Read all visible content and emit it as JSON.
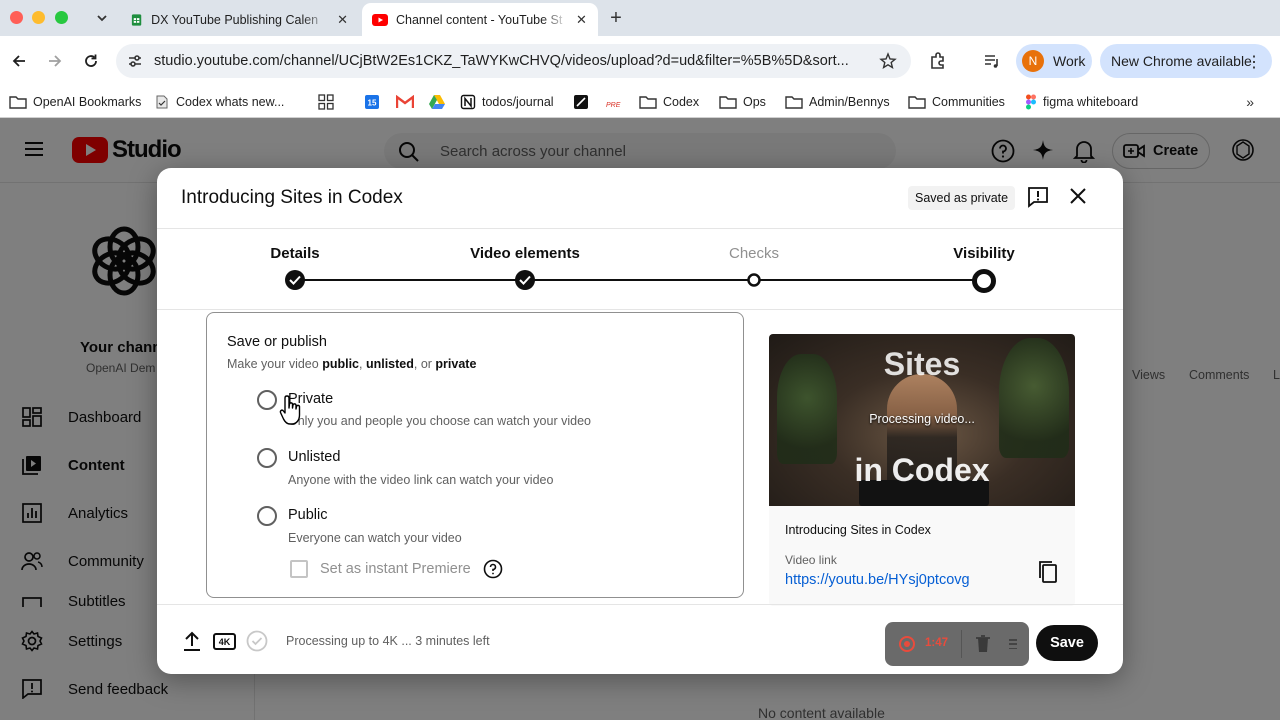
{
  "browser": {
    "tabs": [
      {
        "title": "DX YouTube Publishing Calen",
        "favicon": "sheets-icon"
      },
      {
        "title": "Channel content - YouTube St",
        "favicon": "youtube-icon"
      }
    ],
    "url": "studio.youtube.com/channel/UCjBtW2Es1CKZ_TaWYKwCHVQ/videos/upload?d=ud&filter=%5B%5D&sort...",
    "profile": {
      "initial": "N",
      "label": "Work"
    },
    "update_label": "New Chrome available",
    "bookmarks": [
      {
        "label": "OpenAI Bookmarks",
        "icon": "folder-icon"
      },
      {
        "label": "Codex whats new...",
        "icon": "page-icon"
      },
      {
        "label": "",
        "icon": "grid-icon"
      },
      {
        "label": "",
        "icon": "calendar-icon"
      },
      {
        "label": "",
        "icon": "gmail-icon"
      },
      {
        "label": "",
        "icon": "drive-icon"
      },
      {
        "label": "todos/journal",
        "icon": "notion-icon"
      },
      {
        "label": "",
        "icon": "bookmark-icon"
      },
      {
        "label": "",
        "icon": "pre-icon"
      },
      {
        "label": "Codex",
        "icon": "folder-icon"
      },
      {
        "label": "Ops",
        "icon": "folder-icon"
      },
      {
        "label": "Admin/Bennys",
        "icon": "folder-icon"
      },
      {
        "label": "Communities",
        "icon": "folder-icon"
      },
      {
        "label": "figma whiteboard",
        "icon": "figma-icon"
      }
    ]
  },
  "studio": {
    "logo_text": "Studio",
    "search_placeholder": "Search across your channel",
    "create_label": "Create",
    "channel_name": "Your chann",
    "channel_sub": "OpenAI Dem",
    "nav": [
      {
        "label": "Dashboard",
        "icon": "dashboard-icon"
      },
      {
        "label": "Content",
        "icon": "content-icon"
      },
      {
        "label": "Analytics",
        "icon": "analytics-icon"
      },
      {
        "label": "Community",
        "icon": "community-icon"
      },
      {
        "label": "Subtitles",
        "icon": "subtitles-icon"
      },
      {
        "label": "Settings",
        "icon": "settings-icon"
      },
      {
        "label": "Send feedback",
        "icon": "feedback-icon"
      }
    ],
    "columns": [
      "Views",
      "Comments",
      "L"
    ],
    "empty_text": "No content available"
  },
  "dialog": {
    "title": "Introducing Sites in Codex",
    "saved_badge": "Saved as private",
    "steps": [
      {
        "label": "Details",
        "state": "done"
      },
      {
        "label": "Video elements",
        "state": "done"
      },
      {
        "label": "Checks",
        "state": "pending"
      },
      {
        "label": "Visibility",
        "state": "current"
      }
    ],
    "publish": {
      "title": "Save or publish",
      "subtitle_prefix": "Make your video ",
      "subtitle_public": "public",
      "subtitle_sep1": ", ",
      "subtitle_unlisted": "unlisted",
      "subtitle_sep2": ", or ",
      "subtitle_private": "private",
      "options": [
        {
          "label": "Private",
          "desc": "Only you and people you choose can watch your video"
        },
        {
          "label": "Unlisted",
          "desc": "Anyone with the video link can watch your video"
        },
        {
          "label": "Public",
          "desc": "Everyone can watch your video"
        }
      ],
      "premiere_label": "Set as instant Premiere"
    },
    "preview": {
      "thumb_text_top": "Sites",
      "thumb_text_bottom": "in Codex",
      "processing": "Processing video...",
      "video_title": "Introducing Sites in Codex",
      "link_label": "Video link",
      "link": "https://youtu.be/HYsj0ptcovg"
    },
    "footer": {
      "badge_4k": "4K",
      "status": "Processing up to 4K ... 3 minutes left",
      "recording_time": "1:47",
      "save_label": "Save"
    }
  }
}
